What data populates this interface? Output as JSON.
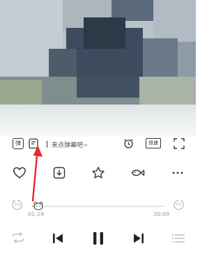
{
  "video": {
    "alt": "video frame (pixelated)"
  },
  "danmu": {
    "toggle_label": "弹",
    "placeholder": "来点弹幕吧~"
  },
  "controls": {
    "speed_label": "倍速"
  },
  "progress": {
    "current": "01:29",
    "total": "30:09",
    "percent": 0.049,
    "rewind_label": "15s",
    "forward_label": "15s"
  },
  "colors": {
    "accent": "#e8282b",
    "icon": "#333333",
    "muted": "#b5b5b5"
  }
}
